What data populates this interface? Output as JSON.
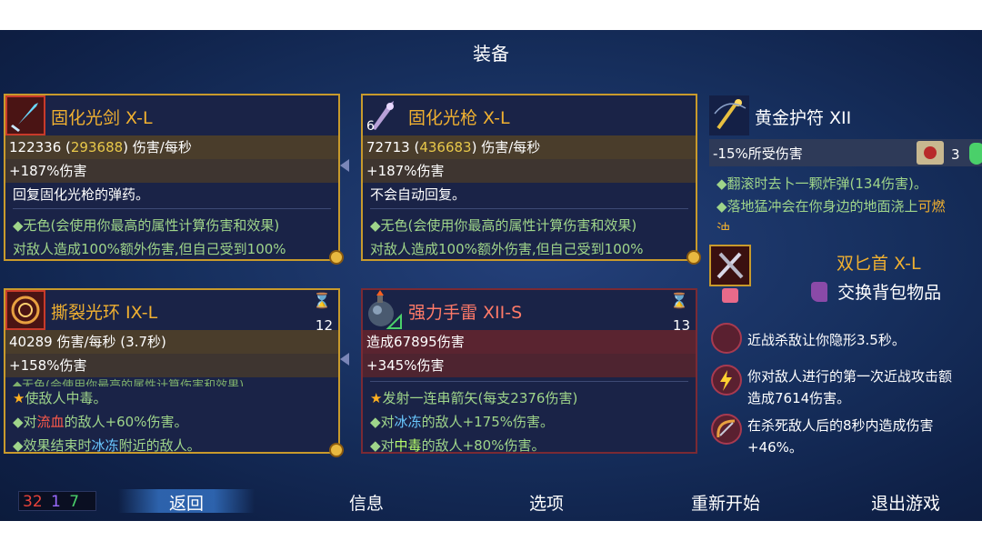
{
  "header": {
    "title": "装备"
  },
  "cards": [
    {
      "name": "固化光剑 X-L",
      "dps_base": "122336",
      "dps_max": "293688",
      "dps_suffix": "伤害/每秒",
      "bonus": "+187%伤害",
      "desc": "回复固化光枪的弹药。",
      "lines": [
        "◆无色(会使用你最高的属性计算伤害和效果)",
        "对敌人造成100%额外伤害,但自己受到100%"
      ]
    },
    {
      "name": "固化光枪 X-L",
      "badge": "6",
      "dps_base": "72713",
      "dps_max": "436683",
      "dps_suffix": "伤害/每秒",
      "bonus": "+187%伤害",
      "desc": "不会自动回复。",
      "lines": [
        "◆无色(会使用你最高的属性计算伤害和效果)",
        "对敌人造成100%额外伤害,但自己受到100%"
      ]
    },
    {
      "name": "撕裂光环 IX-L",
      "count": "12",
      "dps_text": "40289 伤害/每秒 (3.7秒)",
      "bonus": "+158%伤害",
      "top_cut": "◆无色(会使用你最高的属性计算伤害和效果)",
      "lines": [
        "使敌人中毒。",
        "◆对",
        "流血",
        "的敌人+60%伤害。",
        "◆效果结束时",
        "冰冻",
        "附近的敌人。"
      ]
    },
    {
      "name": "强力手雷 XII-S",
      "count": "13",
      "dps_text": "造成67895伤害",
      "bonus": "+345%伤害",
      "lines": [
        "发射一连串箭矢(每支2376伤害)",
        "◆对",
        "冰冻",
        "的敌人+175%伤害。",
        "◆对",
        "中毒",
        "的敌人+80%伤害。"
      ]
    }
  ],
  "amulet": {
    "name": "黄金护符 XII",
    "stat": "-15%所受伤害",
    "scroll_count": "3",
    "line1": "◆翻滚时去卜一颗炸弹(134伤害)。",
    "line2a": "◆落地猛冲会在你身边的地面浇上",
    "line2b": "可燃",
    "line3": "油"
  },
  "backpack": {
    "name": "双匕首 X-L",
    "swap_label": "交换背包物品"
  },
  "mutations": [
    {
      "text": "近战杀敌让你隐形3.5秒。"
    },
    {
      "text1": "你对敌人进行的第一次近战攻击额",
      "text2": "造成7614伤害。"
    },
    {
      "text1": "在杀死敌人后的8秒内造成伤害",
      "text2": "+46%。"
    }
  ],
  "stats_counts": {
    "brutality": "32",
    "tactics": "1",
    "survival": "7",
    "colors": {
      "brutality": "#e8433a",
      "tactics": "#9a6aff",
      "survival": "#4ad06a"
    }
  },
  "menu": {
    "back": "返回",
    "info": "信息",
    "options": "选项",
    "restart": "重新开始",
    "quit": "退出游戏"
  }
}
